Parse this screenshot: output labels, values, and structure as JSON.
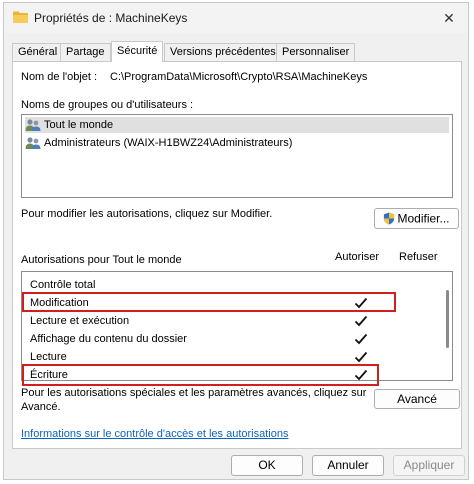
{
  "window": {
    "title": "Propriétés de : MachineKeys",
    "close_glyph": "✕"
  },
  "tabs": [
    {
      "label": "Général"
    },
    {
      "label": "Partage"
    },
    {
      "label": "Sécurité"
    },
    {
      "label": "Versions précédentes"
    },
    {
      "label": "Personnaliser"
    }
  ],
  "active_tab": "Sécurité",
  "object": {
    "label": "Nom de l'objet :",
    "path": "C:\\ProgramData\\Microsoft\\Crypto\\RSA\\MachineKeys"
  },
  "groups": {
    "label": "Noms de groupes ou d'utilisateurs :",
    "items": [
      {
        "name": "Tout le monde",
        "selected": true,
        "icon": "users-icon"
      },
      {
        "name": "Administrateurs (WAIX-H1BWZ24\\Administrateurs)",
        "selected": false,
        "icon": "users-icon"
      }
    ]
  },
  "modify": {
    "hint": "Pour modifier les autorisations, cliquez sur Modifier.",
    "button": "Modifier..."
  },
  "permissions": {
    "label": "Autorisations pour Tout le monde",
    "allow_header": "Autoriser",
    "deny_header": "Refuser",
    "check_glyph": "✓",
    "rows": [
      {
        "name": "Contrôle total",
        "allow": false,
        "highlighted": false
      },
      {
        "name": "Modification",
        "allow": true,
        "highlighted": true
      },
      {
        "name": "Lecture et exécution",
        "allow": true,
        "highlighted": false
      },
      {
        "name": "Affichage du contenu du dossier",
        "allow": true,
        "highlighted": false
      },
      {
        "name": "Lecture",
        "allow": true,
        "highlighted": false
      },
      {
        "name": "Écriture",
        "allow": true,
        "highlighted": true
      }
    ]
  },
  "advanced": {
    "hint_line1": "Pour les autorisations spéciales et les paramètres avancés, cliquez sur",
    "hint_line2": "Avancé.",
    "button": "Avancé"
  },
  "link": "Informations sur le contrôle d'accès et les autorisations",
  "footer": {
    "ok": "OK",
    "cancel": "Annuler",
    "apply": "Appliquer"
  },
  "colors": {
    "highlight": "#d01f1f",
    "link": "#0b63c1",
    "shield_blue": "#2f6fd0",
    "shield_yellow": "#f2c230"
  }
}
